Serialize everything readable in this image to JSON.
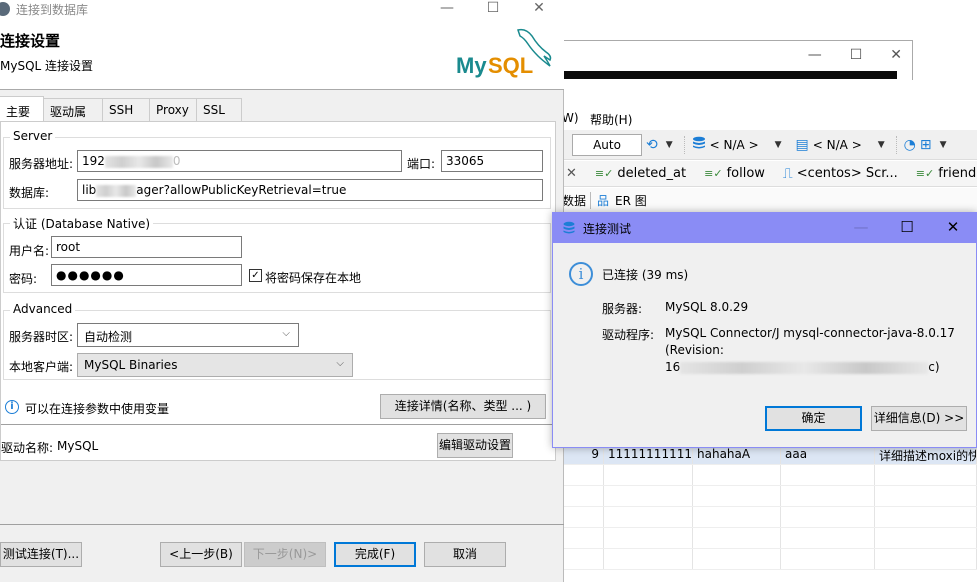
{
  "background_app": {
    "menu_partial": "W)",
    "menu_help": "帮助(H)",
    "toolbar": {
      "auto_value": "Auto",
      "datasource_value": "< N/A >",
      "schema_value": "< N/A >"
    },
    "editor_tabs": [
      {
        "label": "deleted_at",
        "icon": "table-check-icon"
      },
      {
        "label": "follow",
        "icon": "table-check-icon"
      },
      {
        "label": "<centos> Scr...",
        "icon": "script-icon"
      },
      {
        "label": "friend",
        "icon": "table-check-icon"
      }
    ],
    "sub_tabs": [
      {
        "label": "数据",
        "icon": ""
      },
      {
        "label": "ER 图",
        "icon": "er-diagram-icon"
      }
    ],
    "grid_rows": [
      {
        "cells": [
          "9",
          "11111111111",
          "hahahaA",
          "aaa",
          "详细描述moxi的快"
        ],
        "selected": true
      },
      {
        "cells": [
          "",
          "",
          "",
          "",
          ""
        ],
        "selected": false
      },
      {
        "cells": [
          "",
          "",
          "",
          "",
          ""
        ],
        "selected": false
      },
      {
        "cells": [
          "",
          "",
          "",
          "",
          ""
        ],
        "selected": false
      },
      {
        "cells": [
          "",
          "",
          "",
          "",
          ""
        ],
        "selected": false
      },
      {
        "cells": [
          "",
          "",
          "",
          "",
          ""
        ],
        "selected": false
      }
    ]
  },
  "dialog": {
    "window_title": "连接到数据库",
    "header_title": "连接设置",
    "header_subtitle": "MySQL 连接设置",
    "logo_text_my": "My",
    "logo_text_sql": "SQL",
    "tabs": [
      "主要",
      "驱动属性",
      "SSH",
      "Proxy",
      "SSL"
    ],
    "active_tab": "主要",
    "server_group": {
      "legend": "Server",
      "host_label": "服务器地址:",
      "host_value_visible_prefix": "192",
      "host_value_visible_suffix": "0",
      "port_label": "端口:",
      "port_value": "33065",
      "database_label": "数据库:",
      "database_value_visible_prefix": "lib",
      "database_value_visible_suffix": "ager?allowPublicKeyRetrieval=true"
    },
    "auth_group": {
      "legend": "认证 (Database Native)",
      "username_label": "用户名:",
      "username_value": "root",
      "password_label": "密码:",
      "password_masked": "●●●●●●",
      "save_password_label": "将密码保存在本地",
      "save_password_checked": true
    },
    "advanced_group": {
      "legend": "Advanced",
      "timezone_label": "服务器时区:",
      "timezone_value": "自动检测",
      "local_client_label": "本地客户端:",
      "local_client_value": "MySQL Binaries"
    },
    "variables_hint": "可以在连接参数中使用变量",
    "connection_details_button": "连接详情(名称、类型 ... )",
    "driver_name_label": "驱动名称:",
    "driver_name_value": "MySQL",
    "edit_driver_button": "编辑驱动设置",
    "buttons": {
      "test_connection": "测试连接(T)...",
      "back": "<上一步(B)",
      "next": "下一步(N)>",
      "finish": "完成(F)",
      "cancel": "取消"
    }
  },
  "popup": {
    "title": "连接测试",
    "status": "已连接 (39 ms)",
    "server_label": "服务器:",
    "server_value": "MySQL 8.0.29",
    "driver_label": "驱动程序:",
    "driver_line1": "MySQL Connector/J mysql-connector-java-8.0.17",
    "driver_line2": "(Revision:",
    "driver_line3_prefix": "16",
    "driver_line3_suffix": "c)",
    "ok_button": "确定",
    "details_button": "详细信息(D) >>",
    "title_bar_color": "#8a8cf5"
  }
}
